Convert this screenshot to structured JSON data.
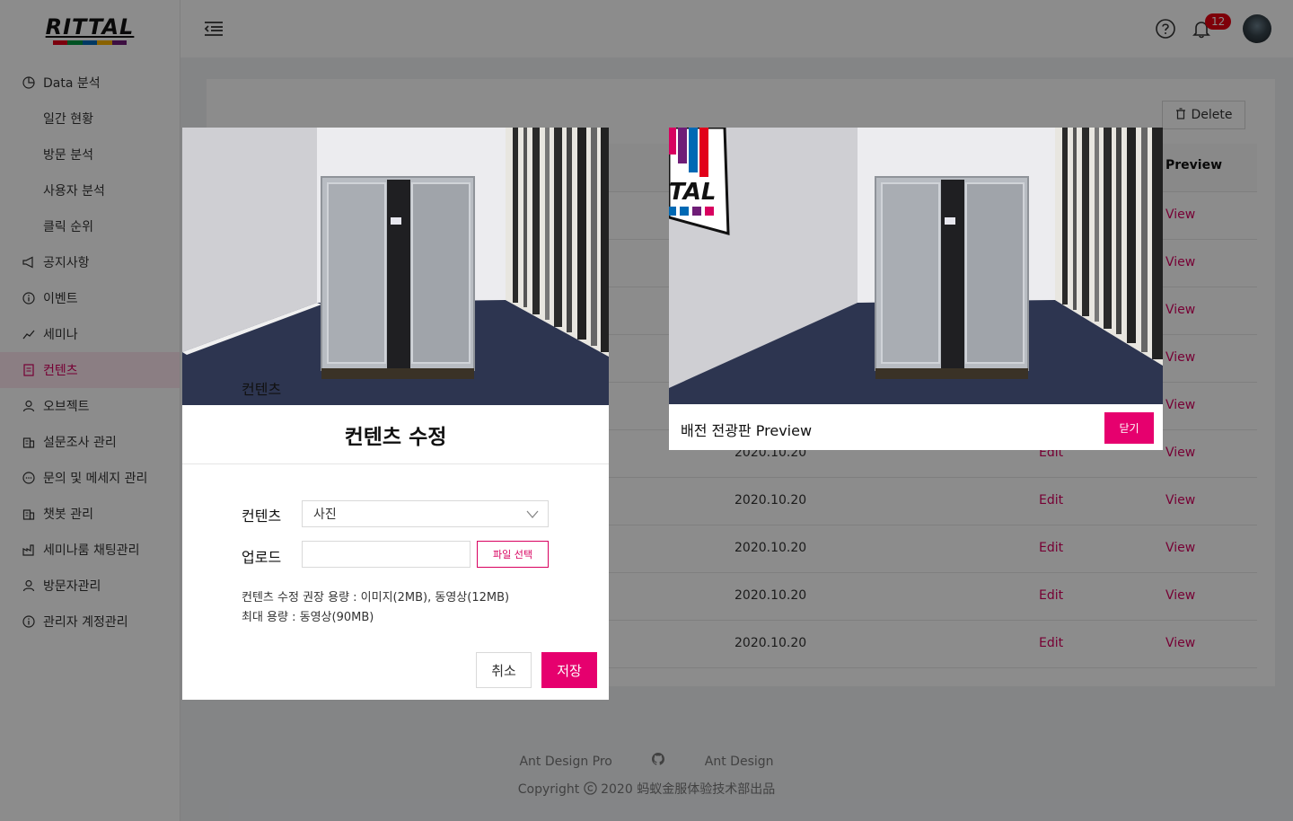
{
  "brand": {
    "logo_text": "RITTAL",
    "stripe_colors": [
      "#e2001a",
      "#009640",
      "#0069b4",
      "#f9b200",
      "#6f1d77"
    ],
    "accent": "#d8005f"
  },
  "sidebar": {
    "items": [
      {
        "label": "Data 분석",
        "icon": "pie-chart-icon",
        "sub": false,
        "active": false
      },
      {
        "label": "일간 현황",
        "icon": "",
        "sub": true,
        "active": false
      },
      {
        "label": "방문 분석",
        "icon": "",
        "sub": true,
        "active": false
      },
      {
        "label": "사용자 분석",
        "icon": "",
        "sub": true,
        "active": false
      },
      {
        "label": "클릭 순위",
        "icon": "",
        "sub": true,
        "active": false
      },
      {
        "label": "공지사항",
        "icon": "megaphone-icon",
        "sub": false,
        "active": false
      },
      {
        "label": "이벤트",
        "icon": "info-circle-icon",
        "sub": false,
        "active": false
      },
      {
        "label": "세미나",
        "icon": "line-chart-icon",
        "sub": false,
        "active": false
      },
      {
        "label": "컨텐츠",
        "icon": "document-icon",
        "sub": false,
        "active": true
      },
      {
        "label": "오브젝트",
        "icon": "user-icon",
        "sub": false,
        "active": false
      },
      {
        "label": "설문조사 관리",
        "icon": "building-icon",
        "sub": false,
        "active": false
      },
      {
        "label": "문의 및 메세지 관리",
        "icon": "message-icon",
        "sub": false,
        "active": false
      },
      {
        "label": "챗봇 관리",
        "icon": "building-icon",
        "sub": false,
        "active": false
      },
      {
        "label": "세미나룸 채팅관리",
        "icon": "factory-icon",
        "sub": false,
        "active": false
      },
      {
        "label": "방문자관리",
        "icon": "user-icon",
        "sub": false,
        "active": false
      },
      {
        "label": "관리자 계정관리",
        "icon": "info-circle-icon",
        "sub": false,
        "active": false
      }
    ]
  },
  "header": {
    "notification_count": "12"
  },
  "toolbar": {
    "delete_label": "Delete"
  },
  "table": {
    "preview_header": "Preview",
    "rows": [
      {
        "date": "",
        "edit": "",
        "view": "View"
      },
      {
        "date": "",
        "edit": "",
        "view": "View"
      },
      {
        "date": "",
        "edit": "",
        "view": "View"
      },
      {
        "date": "",
        "edit": "",
        "view": "View"
      },
      {
        "date": "",
        "edit": "",
        "view": "View"
      },
      {
        "date": "2020.10.20",
        "edit": "Edit",
        "view": "View"
      },
      {
        "date": "2020.10.20",
        "edit": "Edit",
        "view": "View"
      },
      {
        "date": "2020.10.20",
        "edit": "Edit",
        "view": "View"
      },
      {
        "date": "2020.10.20",
        "edit": "Edit",
        "view": "View"
      },
      {
        "date": "2020.10.20",
        "edit": "Edit",
        "view": "View"
      }
    ]
  },
  "footer": {
    "link1": "Ant Design Pro",
    "link2": "Ant Design",
    "copyright": "Copyright",
    "copyright_text": "2020 蚂蚁金服体验技术部出品"
  },
  "edit_modal": {
    "title": "컨텐츠 수정",
    "content_label": "컨텐츠",
    "content_value": "사진",
    "upload_label": "업로드",
    "upload_value": "",
    "file_button": "파일 선택",
    "note1": "컨텐츠 수정 권장 용량  : 이미지(2MB), 동영상(12MB)",
    "note2": "최대 용량 : 동영상(90MB)",
    "cancel": "취소",
    "save": "저장"
  },
  "preview_modal": {
    "title": "배전 전광판 Preview",
    "close": "닫기",
    "poster_text": "TAL"
  }
}
